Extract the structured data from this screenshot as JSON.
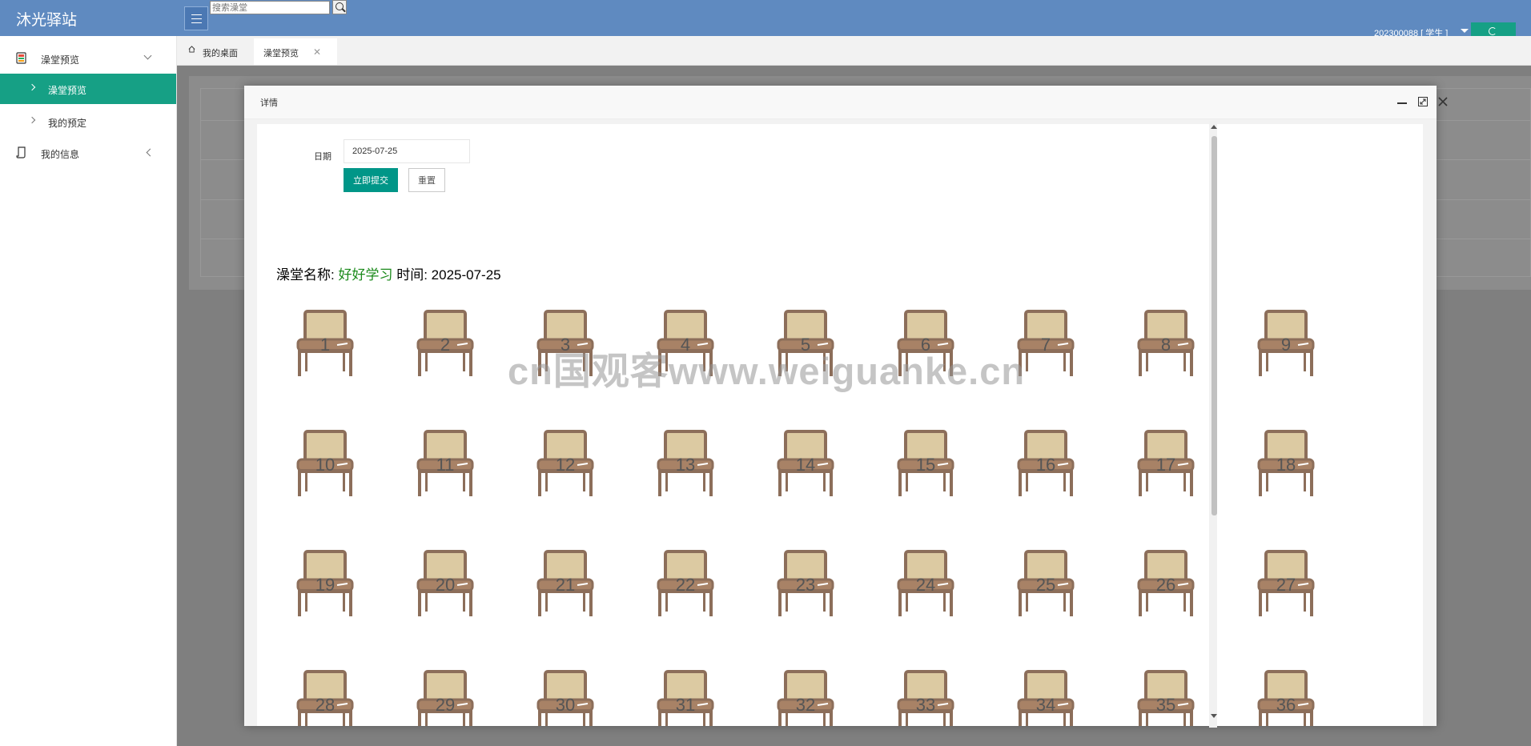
{
  "header": {
    "logo": "沐光驿站",
    "search_placeholder": "搜索澡堂",
    "user_info": "202300088 [ 学生 ]"
  },
  "sidebar": {
    "items": [
      {
        "label": "澡堂预览"
      },
      {
        "label": "澡堂预览"
      },
      {
        "label": "我的预定"
      },
      {
        "label": "我的信息"
      }
    ]
  },
  "tabs": [
    {
      "label": "我的桌面"
    },
    {
      "label": "澡堂预览"
    }
  ],
  "modal": {
    "title": "详情",
    "form": {
      "date_label": "日期",
      "date_value": "2025-07-25",
      "submit_label": "立即提交",
      "reset_label": "重置"
    },
    "info": {
      "name_label": "澡堂名称:",
      "name_value": "好好学习",
      "time_label": "时间:",
      "time_value": "2025-07-25"
    },
    "seats": [
      "1",
      "2",
      "3",
      "4",
      "5",
      "6",
      "7",
      "8",
      "9",
      "10",
      "11",
      "12",
      "13",
      "14",
      "15",
      "16",
      "17",
      "18",
      "19",
      "20",
      "21",
      "22",
      "23",
      "24",
      "25",
      "26",
      "27",
      "28",
      "29",
      "30",
      "31",
      "32",
      "33",
      "34",
      "35",
      "36"
    ]
  },
  "watermark": "cn国观客www.weiguanke.cn",
  "colors": {
    "header": "#5f8ac0",
    "accent": "#16a085",
    "chair_back": "#dccaa2",
    "chair_frame": "#8c6e5a",
    "chair_seat": "#a88266"
  }
}
